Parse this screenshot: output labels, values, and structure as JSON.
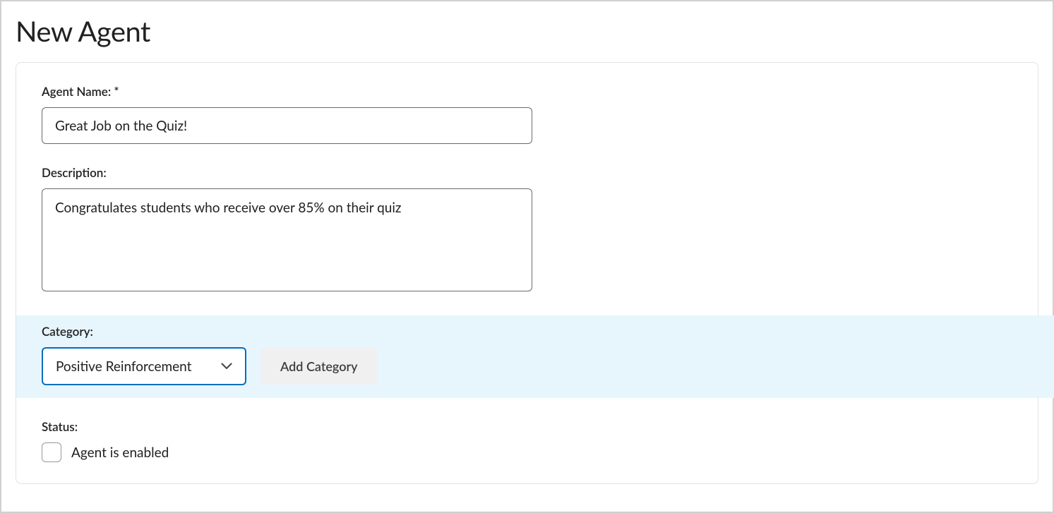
{
  "page": {
    "title": "New Agent"
  },
  "form": {
    "agent_name_label": "Agent Name: *",
    "agent_name_value": "Great Job on the Quiz!",
    "description_label": "Description:",
    "description_value": "Congratulates students who receive over 85% on their quiz",
    "category_label": "Category:",
    "category_selected": "Positive Reinforcement",
    "add_category_label": "Add Category",
    "status_label": "Status:",
    "status_checkbox_label": "Agent is enabled",
    "status_checked": false
  }
}
